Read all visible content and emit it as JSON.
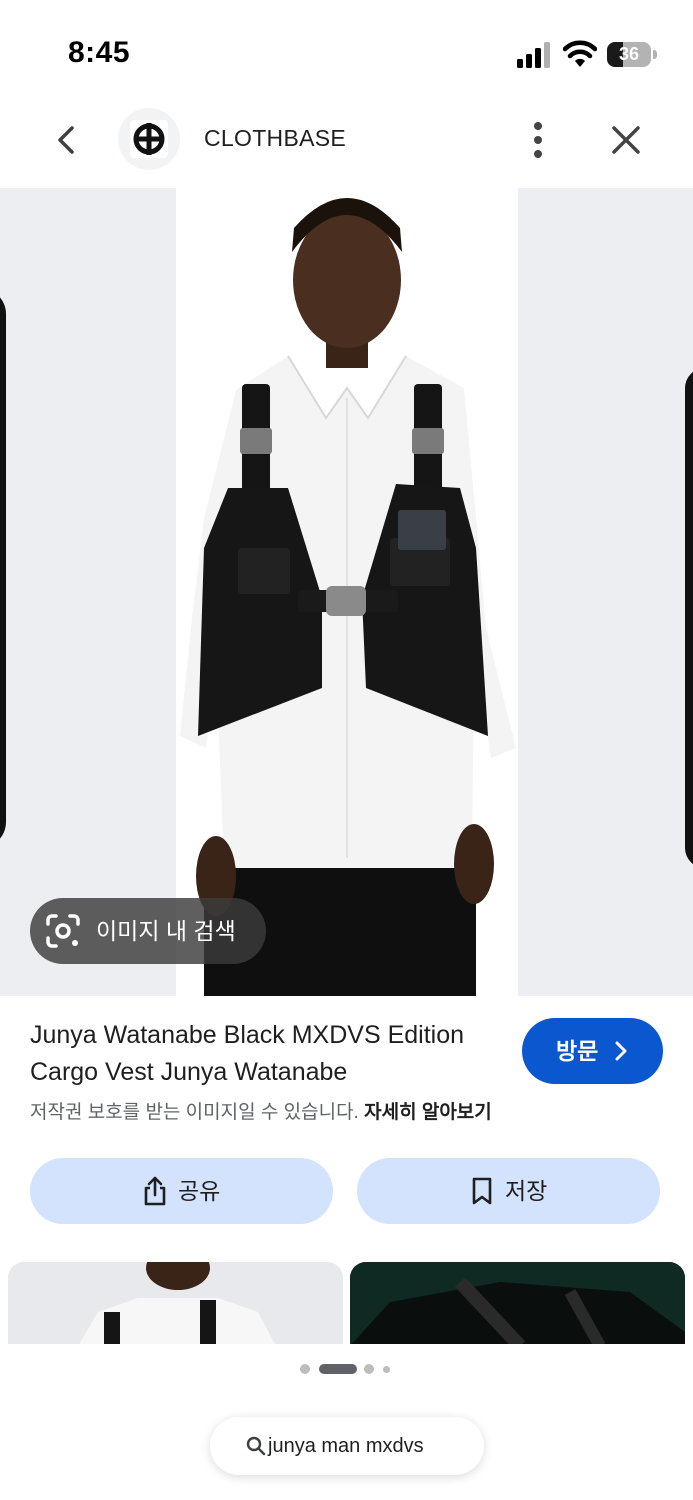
{
  "status_bar": {
    "time": "8:45",
    "battery_level": "36",
    "battery_fraction": 0.36
  },
  "header": {
    "site_name": "CLOTHBASE",
    "icons": [
      "back-arrow-icon",
      "site-logo-icon",
      "more-vert-icon",
      "close-icon"
    ]
  },
  "image_viewer": {
    "lens_chip_label": "이미지 내 검색"
  },
  "result": {
    "title": "Junya Watanabe Black MXDVS Edition Cargo Vest Junya Watanabe",
    "visit_label": "방문",
    "copyright_notice": "저작권 보호를 받는 이미지일 수 있습니다.",
    "learn_more": "자세히 알아보기"
  },
  "actions": {
    "share_label": "공유",
    "save_label": "저장"
  },
  "pagination": {
    "dot_count": 4,
    "active_index": 1
  },
  "search": {
    "query": "junya man mxdvs"
  },
  "colors": {
    "accent": "#0b57d0",
    "tonal_button": "#d3e3fd",
    "chip_background": "#3c3c3c",
    "image_backdrop": "#eceef1"
  }
}
